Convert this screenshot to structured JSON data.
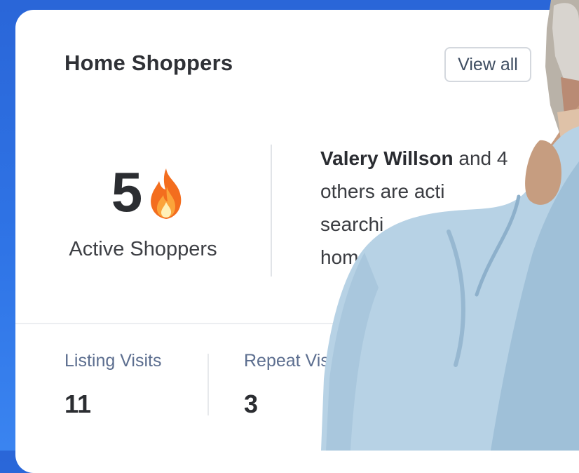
{
  "card": {
    "title": "Home Shoppers",
    "view_all_label": "View all"
  },
  "metric": {
    "value": "5",
    "label": "Active Shoppers",
    "icon": "fire-icon"
  },
  "activity": {
    "name": "Valery Willson",
    "lines": [
      "and 4",
      "others are acti",
      "searchi",
      "hom"
    ]
  },
  "stats": [
    {
      "label": "Listing Visits",
      "value": "11"
    },
    {
      "label": "Repeat Vis",
      "value": "3"
    }
  ],
  "colors": {
    "background": "#2f74e6",
    "card": "#ffffff",
    "stat_label": "#5c6e8f",
    "shirt": "#b8d4e8"
  }
}
